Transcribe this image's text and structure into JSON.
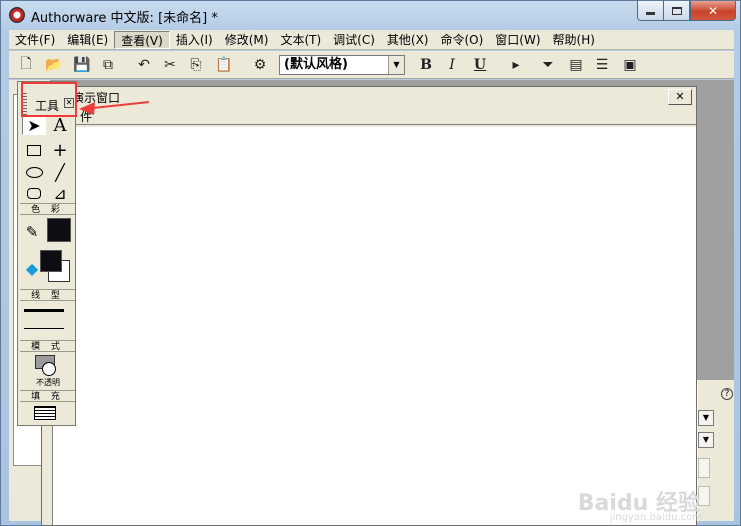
{
  "window": {
    "title": "Authorware 中文版: [未命名] *"
  },
  "menubar": {
    "items": [
      "文件(F)",
      "编辑(E)",
      "查看(V)",
      "插入(I)",
      "修改(M)",
      "文本(T)",
      "调试(C)",
      "其他(X)",
      "命令(O)",
      "窗口(W)",
      "帮助(H)"
    ],
    "active_index": 2
  },
  "toolbar": {
    "text_style": "(默认风格)",
    "bold_label": "B",
    "italic_label": "I",
    "underline_label": "U"
  },
  "presentation_window": {
    "title": "演示窗口",
    "menu_item": "件",
    "close_label": "✕"
  },
  "tools_palette": {
    "title": "工具",
    "text_tool_label": "A",
    "color_label": "色 彩",
    "line_type_label": "线 型",
    "mode_label": "模 式",
    "mode_value": "不透明",
    "fill_label": "填 充"
  },
  "annotation": {
    "highlight_color": "#ef3b3b"
  },
  "watermark": {
    "text": "Baidu 经验",
    "sub": "jingyan.baidu.com"
  },
  "right_panel": {
    "help_label": "?"
  }
}
